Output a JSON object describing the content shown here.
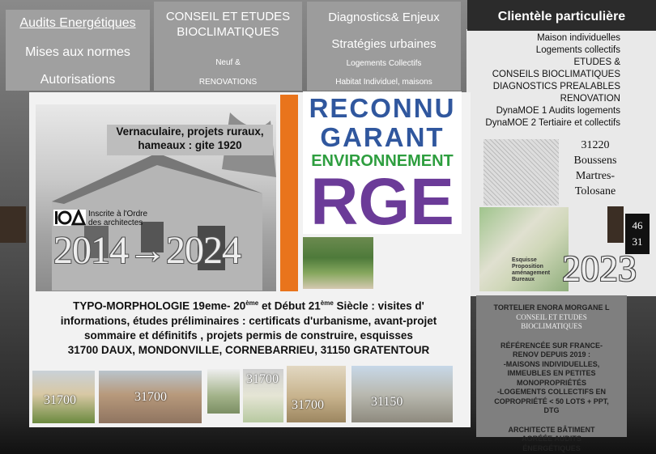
{
  "nav": {
    "col1": {
      "link": "Audits Energétiques",
      "item2": "Mises aux normes",
      "item3": "Autorisations"
    },
    "col2": {
      "title": "CONSEIL ET ETUDES BIOCLIMATIQUES",
      "sub1": "Neuf &",
      "sub2": "RENOVATIONS"
    },
    "col3": {
      "title": "Diagnostics& Enjeux",
      "title2": "Stratégies urbaines",
      "sub1": "Logements Collectifs",
      "sub2": "Habitat Individuel, maisons"
    }
  },
  "client": {
    "title": "Clientèle particulière",
    "items": [
      "Maison individuelles",
      "Logements collectifs",
      "ETUDES &",
      "CONSEILS BIOCLIMATIQUES",
      "DIAGNOSTICS PREALABLES",
      "RENOVATION",
      "DynaMOE 1 Audits logements",
      "DynaMOE 2 Tertiaire et collectifs"
    ]
  },
  "main": {
    "caption": "Vernaculaire, projets ruraux, hameaux : gite 1920",
    "oa_text1": "Inscrite à l'Ordre",
    "oa_text2": "des architectes",
    "years": "2014→2024",
    "rge": {
      "l1": "RECONNU",
      "l2": "GARANT",
      "l3": "ENVIRONNEMENT",
      "l4": "RGE"
    },
    "typo_a": "TYPO-MORPHOLOGIE 19eme- 20",
    "typo_sup1": "ème",
    "typo_b": " et Début 21",
    "typo_sup2": "ème",
    "typo_c": " Siècle : visites d' informations, études préliminaires : certificats d'urbanisme, avant-projet sommaire et définitifs , projets permis de construire, esquisses",
    "typo_d": "31700 DAUX, MONDONVILLE, CORNEBARRIEU, 31150 GRATENTOUR"
  },
  "thumbs": [
    "31700",
    "31700",
    "31700",
    "31700",
    "31150"
  ],
  "address": [
    "31220",
    "Boussens",
    "Martres-",
    "Tolosane"
  ],
  "year2023": "2023",
  "dept": [
    "46",
    "31"
  ],
  "collage_label": "Esquisse Proposition aménagement Bureaux",
  "panel": {
    "name": "TORTELIER ENORA MORGANE L",
    "conseil": "CONSEIL ET ETUDES BIOCLIMATIQUES",
    "ref": "RÉFÉRENCÉE SUR FRANCE-RENOV DEPUIS 2019 :",
    "line1": "-MAISONS INDIVIDUELLES, IMMEUBLES EN PETITES MONOPROPRIÉTÉS",
    "line2": "-LOGEMENTS COLLECTIFS EN COPROPRIÉTÉ < 50 LOTS + PPT, DTG",
    "arch": "ARCHITECTE BÂTIMENT AGRÉÉE AUDITS ÉNERGÉTIQUES"
  }
}
